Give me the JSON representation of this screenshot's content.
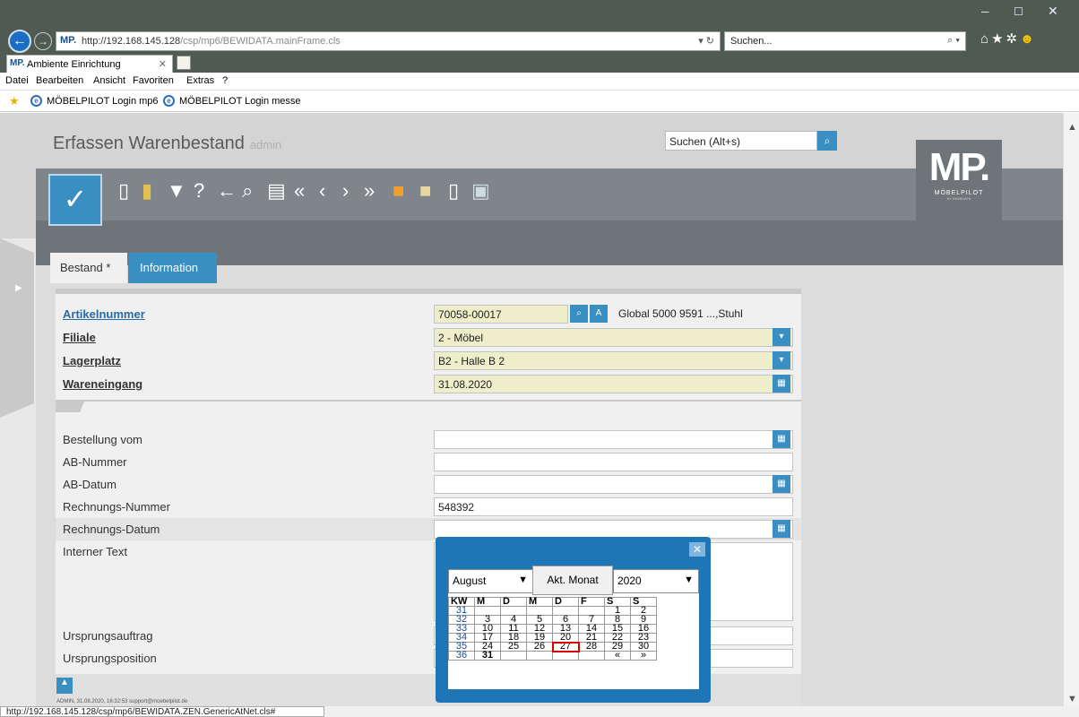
{
  "browser": {
    "url_host": "http://192.168.145.128",
    "url_path": "/csp/mp6/BEWIDATA.mainFrame.cls",
    "search_placeholder": "Suchen...",
    "tab_title": "Ambiente Einrichtung",
    "menu": [
      "Datei",
      "Bearbeiten",
      "Ansicht",
      "Favoriten",
      "Extras",
      "?"
    ],
    "favorites": [
      "MÖBELPILOT Login mp6",
      "MÖBELPILOT Login messe"
    ],
    "status_url": "http://192.168.145.128/csp/mp6/BEWIDATA.ZEN.GenericAtNet.cls#"
  },
  "app": {
    "title": "Erfassen Warenbestand",
    "user": "admin",
    "search_placeholder": "Suchen (Alt+s)",
    "logo_big": "MP.",
    "logo_small": "MÖBELPILOT",
    "logo_tiny": "BY BEWIDATA",
    "tabs": [
      "Bestand *",
      "Information"
    ]
  },
  "form": {
    "artikelnummer_label": "Artikelnummer",
    "artikelnummer_value": "70058-00017",
    "artikel_desc": "Global 5000 9591 ...,Stuhl",
    "filiale_label": "Filiale",
    "filiale_value": "2 - Möbel",
    "lagerplatz_label": "Lagerplatz",
    "lagerplatz_value": "B2 - Halle B 2",
    "wareneingang_label": "Wareneingang",
    "wareneingang_value": "31.08.2020",
    "bestellung_label": "Bestellung vom",
    "ab_nummer_label": "AB-Nummer",
    "ab_datum_label": "AB-Datum",
    "rechnungs_nummer_label": "Rechnungs-Nummer",
    "rechnungs_nummer_value": "548392",
    "rechnungs_datum_label": "Rechnungs-Datum",
    "interner_text_label": "Interner Text",
    "ursprungsauftrag_label": "Ursprungsauftrag",
    "ursprungsposition_label": "Ursprungsposition",
    "footer_info": "ADMIN, 31.08.2020, 16:32:53 support@moebelpilot.de"
  },
  "calendar": {
    "month": "August",
    "current_month_button": "Akt. Monat",
    "year": "2020",
    "headers": [
      "KW",
      "M",
      "D",
      "M",
      "D",
      "F",
      "S",
      "S"
    ],
    "rows": [
      [
        "31",
        "",
        "",
        "",
        "",
        "",
        "1",
        "2"
      ],
      [
        "32",
        "3",
        "4",
        "5",
        "6",
        "7",
        "8",
        "9"
      ],
      [
        "33",
        "10",
        "11",
        "12",
        "13",
        "14",
        "15",
        "16"
      ],
      [
        "34",
        "17",
        "18",
        "19",
        "20",
        "21",
        "22",
        "23"
      ],
      [
        "35",
        "24",
        "25",
        "26",
        "27",
        "28",
        "29",
        "30"
      ],
      [
        "36",
        "31",
        "",
        "",
        "",
        "",
        "«",
        "»"
      ]
    ],
    "highlighted_day": "27"
  }
}
